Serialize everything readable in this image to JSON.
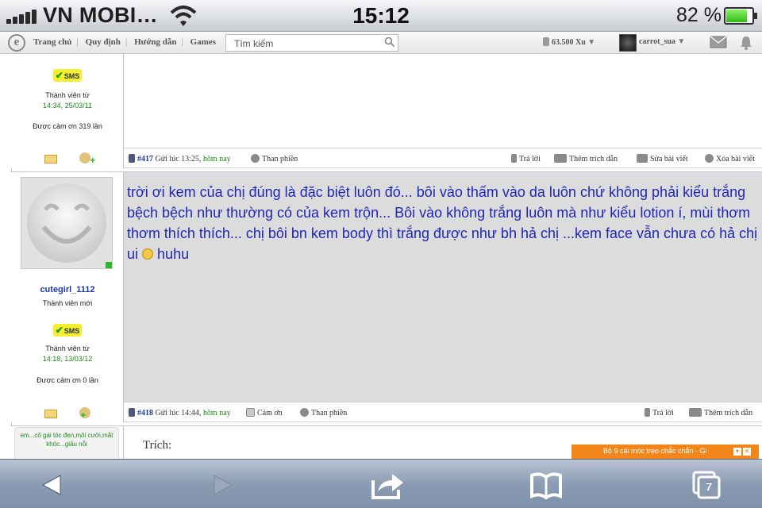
{
  "status_bar": {
    "carrier": "VN MOBI…",
    "time": "15:12",
    "battery_pct": "82 %",
    "battery_level": 0.82
  },
  "topnav": {
    "logo": "e",
    "links": [
      "Trang chủ",
      "Quy định",
      "Hướng dẫn",
      "Games"
    ],
    "search_placeholder": "Tìm kiếm",
    "coins": "63.500 Xu",
    "username": "carrot_sua"
  },
  "post1": {
    "sms_badge": "SMS",
    "member_since_label": "Thành viên từ",
    "member_since": "14:34, 25/03/11",
    "thanks": "Được cảm ơn 319 lần",
    "bar": {
      "number": "#417",
      "sent": "Gửi lúc 13:25,",
      "sent_when": "hôm nay",
      "report": "Than phiền",
      "reply": "Trả lời",
      "add_quote": "Thêm trích dẫn",
      "edit": "Sửa bài viết",
      "delete": "Xóa bài viết"
    }
  },
  "post2": {
    "username": "cutegirl_1112",
    "rank": "Thành viên mới",
    "sms_badge": "SMS",
    "member_since_label": "Thành viên từ",
    "member_since": "14:18, 13/03/12",
    "thanks": "Được cảm ơn 0 lần",
    "text": "trời ơi kem của chị đúng là đặc biệt luôn đó... bôi vào thấm vào da luôn chứ không phải kiểu trắng bệch bệch như thường có của kem trộn... Bôi vào không trắng luôn mà như kiểu lotion í, mùi thơm thơm thích thích... chị bôi bn kem body thì trắng được như bh hả chị ...kem face vẫn chưa có hả chị ui",
    "text_tail": "huhu",
    "bar": {
      "number": "#418",
      "sent": "Gửi lúc 14:44,",
      "sent_when": "hôm nay",
      "thank": "Cảm ơn",
      "report": "Than phiền",
      "reply": "Trả lời",
      "add_quote": "Thêm trích dẫn"
    }
  },
  "post3": {
    "signature": "em...cô gái tóc đen,môi cười,mắt khóc...giấu nỗi",
    "quote_label": "Trích:"
  },
  "ad": {
    "text": "Bộ 9 cái móc treo chắc chắn - Gi"
  },
  "toolbar": {
    "tabs_count": "7"
  },
  "colors": {
    "accent_blue": "#1f27b3",
    "member_green": "#1e8a1e",
    "ad_orange": "#f3861b",
    "post_bg": "#dcdcdc"
  }
}
